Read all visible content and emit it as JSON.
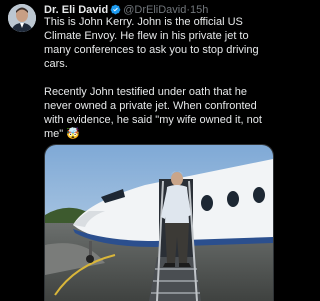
{
  "tweet": {
    "author_name": "Dr. Eli David",
    "handle": "@DrEliDavid",
    "separator": "·",
    "timestamp": "15h",
    "paragraphs": [
      "This is John Kerry. John is the official US Climate Envoy. He flew in his private jet to many conferences to ask you to stop driving cars.",
      "Recently John testified under oath that he never owned a private jet. When confronted with evidence, he said \"my wife owned it, not me\" 🤯"
    ],
    "media": {
      "description_icon": "photo-jet-icon"
    }
  },
  "colors": {
    "background": "#000000",
    "text": "#e7e9ea",
    "secondary": "#71767b",
    "verified_badge": "#1d9bf0"
  }
}
